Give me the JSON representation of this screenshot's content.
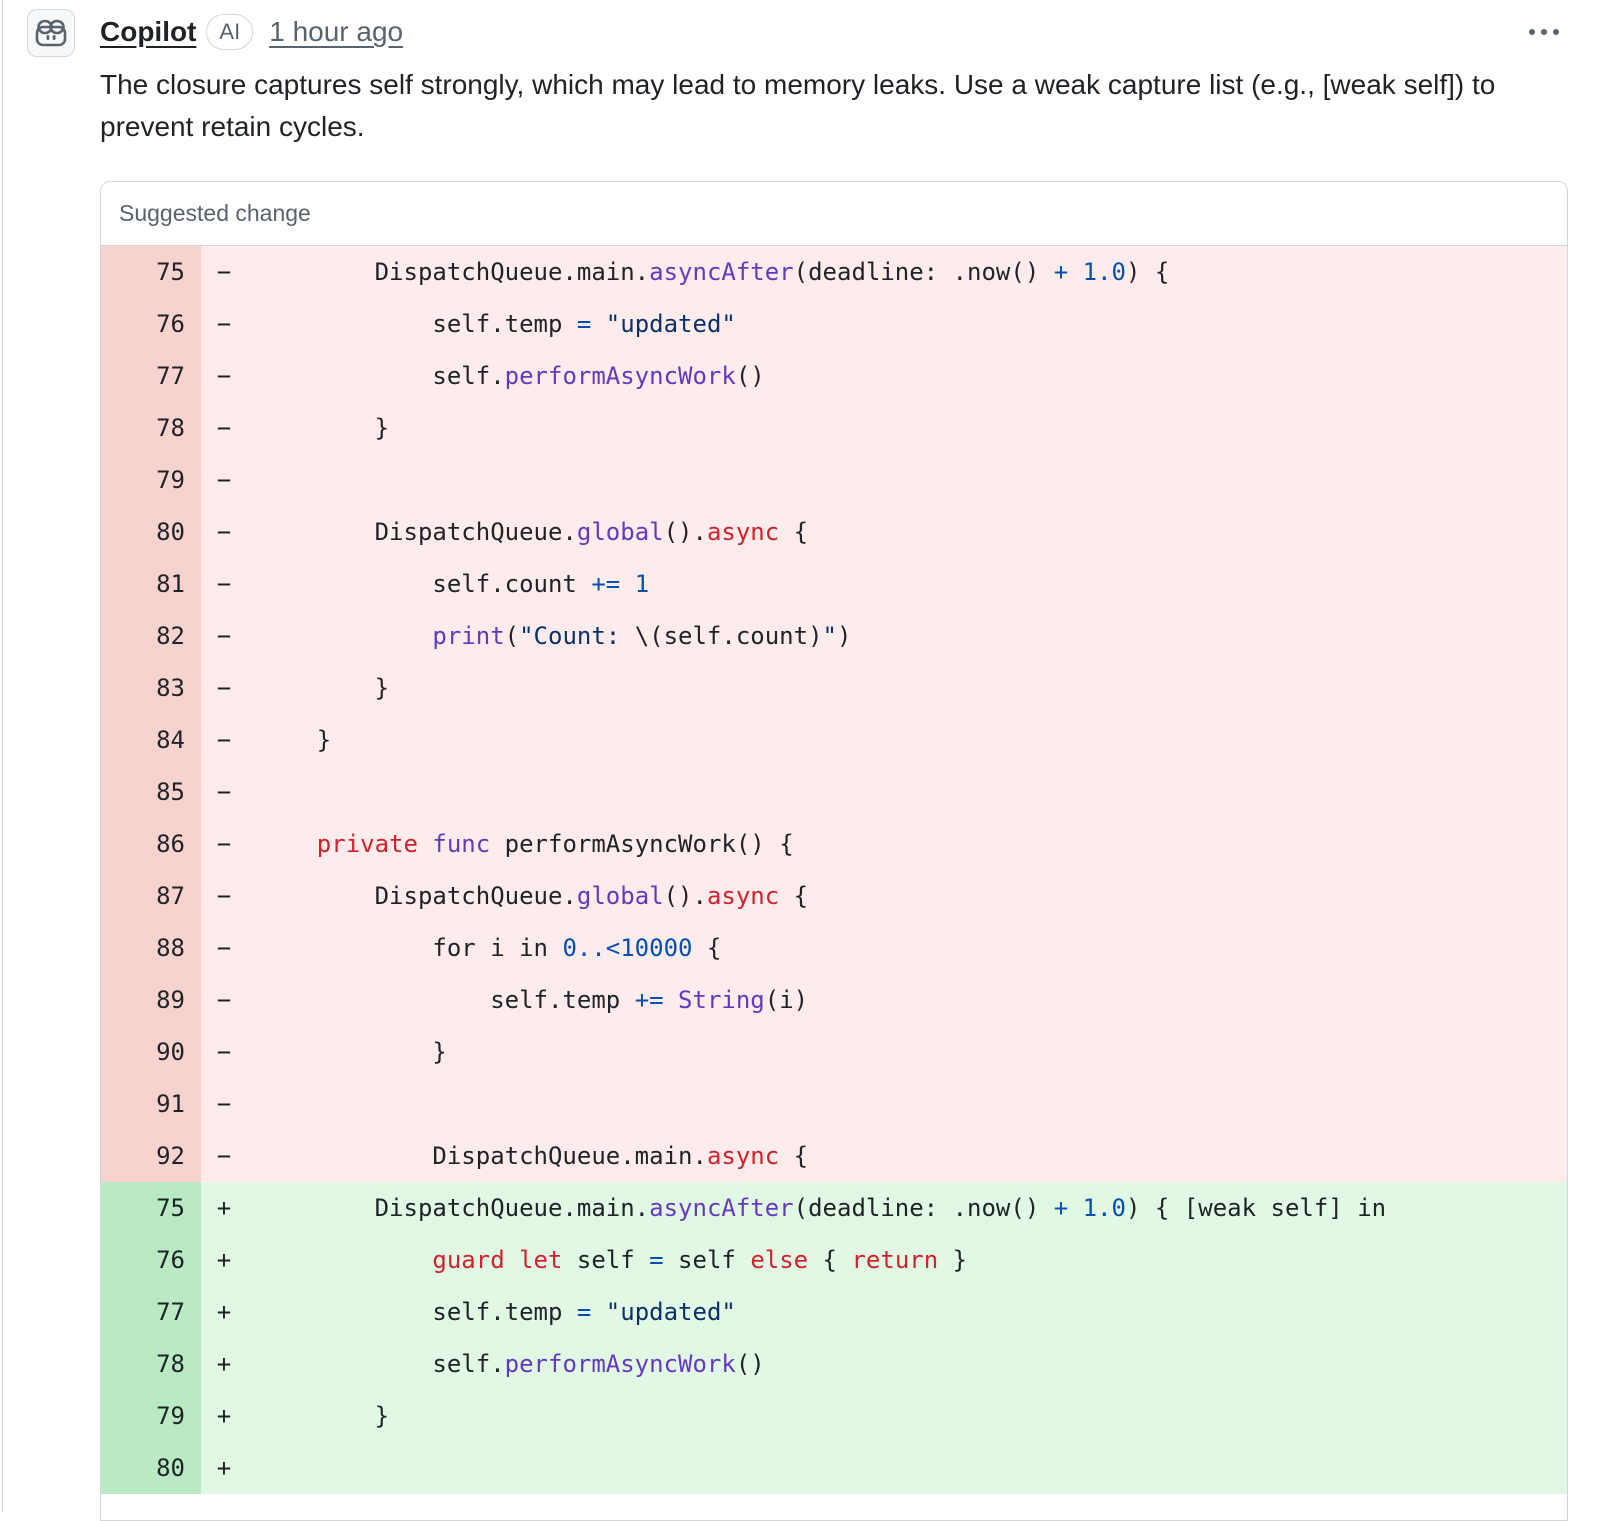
{
  "comment": {
    "author": "Copilot",
    "badge": "AI",
    "time": "1 hour ago",
    "text": "The closure captures self strongly, which may lead to memory leaks. Use a weak capture list (e.g., [weak self]) to prevent retain cycles."
  },
  "suggestion": {
    "header": "Suggested change",
    "lines": [
      {
        "num": "75",
        "mark": "−",
        "type": "del",
        "indent": 8,
        "tokens": [
          [
            "",
            "DispatchQueue.main."
          ],
          [
            "fn",
            "asyncAfter"
          ],
          [
            "",
            "(deadline: .now() "
          ],
          [
            "op",
            "+"
          ],
          [
            "",
            " "
          ],
          [
            "num",
            "1.0"
          ],
          [
            "",
            ") {"
          ]
        ]
      },
      {
        "num": "76",
        "mark": "−",
        "type": "del",
        "indent": 12,
        "tokens": [
          [
            "",
            "self.temp "
          ],
          [
            "op",
            "="
          ],
          [
            "",
            " "
          ],
          [
            "str",
            "\"updated\""
          ]
        ]
      },
      {
        "num": "77",
        "mark": "−",
        "type": "del",
        "indent": 12,
        "tokens": [
          [
            "",
            "self."
          ],
          [
            "fn",
            "performAsyncWork"
          ],
          [
            "",
            "()"
          ]
        ]
      },
      {
        "num": "78",
        "mark": "−",
        "type": "del",
        "indent": 8,
        "tokens": [
          [
            "",
            "}"
          ]
        ]
      },
      {
        "num": "79",
        "mark": "−",
        "type": "del",
        "indent": 0,
        "tokens": []
      },
      {
        "num": "80",
        "mark": "−",
        "type": "del",
        "indent": 8,
        "tokens": [
          [
            "",
            "DispatchQueue."
          ],
          [
            "fn",
            "global"
          ],
          [
            "",
            "()."
          ],
          [
            "kw",
            "async"
          ],
          [
            "",
            " {"
          ]
        ]
      },
      {
        "num": "81",
        "mark": "−",
        "type": "del",
        "indent": 12,
        "tokens": [
          [
            "",
            "self.count "
          ],
          [
            "op",
            "+="
          ],
          [
            "",
            " "
          ],
          [
            "num",
            "1"
          ]
        ]
      },
      {
        "num": "82",
        "mark": "−",
        "type": "del",
        "indent": 12,
        "tokens": [
          [
            "fn",
            "print"
          ],
          [
            "",
            "("
          ],
          [
            "str",
            "\"Count: "
          ],
          [
            "",
            "\\(self.count)"
          ],
          [
            "str",
            "\""
          ],
          [
            "",
            ")"
          ]
        ]
      },
      {
        "num": "83",
        "mark": "−",
        "type": "del",
        "indent": 8,
        "tokens": [
          [
            "",
            "}"
          ]
        ]
      },
      {
        "num": "84",
        "mark": "−",
        "type": "del",
        "indent": 4,
        "tokens": [
          [
            "",
            "}"
          ]
        ]
      },
      {
        "num": "85",
        "mark": "−",
        "type": "del",
        "indent": 0,
        "tokens": []
      },
      {
        "num": "86",
        "mark": "−",
        "type": "del",
        "indent": 4,
        "tokens": [
          [
            "kw",
            "private"
          ],
          [
            "",
            " "
          ],
          [
            "fn",
            "func"
          ],
          [
            "",
            " performAsyncWork() {"
          ]
        ]
      },
      {
        "num": "87",
        "mark": "−",
        "type": "del",
        "indent": 8,
        "tokens": [
          [
            "",
            "DispatchQueue."
          ],
          [
            "fn",
            "global"
          ],
          [
            "",
            "()."
          ],
          [
            "kw",
            "async"
          ],
          [
            "",
            " {"
          ]
        ]
      },
      {
        "num": "88",
        "mark": "−",
        "type": "del",
        "indent": 12,
        "tokens": [
          [
            "",
            "for i in "
          ],
          [
            "num",
            "0..<10000"
          ],
          [
            "",
            " {"
          ]
        ]
      },
      {
        "num": "89",
        "mark": "−",
        "type": "del",
        "indent": 16,
        "tokens": [
          [
            "",
            "self.temp "
          ],
          [
            "op",
            "+="
          ],
          [
            "",
            " "
          ],
          [
            "fn",
            "String"
          ],
          [
            "",
            "(i)"
          ]
        ]
      },
      {
        "num": "90",
        "mark": "−",
        "type": "del",
        "indent": 12,
        "tokens": [
          [
            "",
            "}"
          ]
        ]
      },
      {
        "num": "91",
        "mark": "−",
        "type": "del",
        "indent": 0,
        "tokens": []
      },
      {
        "num": "92",
        "mark": "−",
        "type": "del",
        "indent": 12,
        "tokens": [
          [
            "",
            "DispatchQueue.main."
          ],
          [
            "kw",
            "async"
          ],
          [
            "",
            " {"
          ]
        ]
      },
      {
        "num": "75",
        "mark": "+",
        "type": "add",
        "indent": 8,
        "tokens": [
          [
            "",
            "DispatchQueue.main."
          ],
          [
            "fn",
            "asyncAfter"
          ],
          [
            "",
            "(deadline: .now() "
          ],
          [
            "op",
            "+"
          ],
          [
            "",
            " "
          ],
          [
            "num",
            "1.0"
          ],
          [
            "",
            ") { [weak self] in"
          ]
        ]
      },
      {
        "num": "76",
        "mark": "+",
        "type": "add",
        "indent": 12,
        "tokens": [
          [
            "kw",
            "guard"
          ],
          [
            "",
            " "
          ],
          [
            "kw",
            "let"
          ],
          [
            "",
            " self "
          ],
          [
            "op",
            "="
          ],
          [
            "",
            " self "
          ],
          [
            "kw",
            "else"
          ],
          [
            "",
            " { "
          ],
          [
            "kw",
            "return"
          ],
          [
            "",
            " }"
          ]
        ]
      },
      {
        "num": "77",
        "mark": "+",
        "type": "add",
        "indent": 12,
        "tokens": [
          [
            "",
            "self.temp "
          ],
          [
            "op",
            "="
          ],
          [
            "",
            " "
          ],
          [
            "str",
            "\"updated\""
          ]
        ]
      },
      {
        "num": "78",
        "mark": "+",
        "type": "add",
        "indent": 12,
        "tokens": [
          [
            "",
            "self."
          ],
          [
            "fn",
            "performAsyncWork"
          ],
          [
            "",
            "()"
          ]
        ]
      },
      {
        "num": "79",
        "mark": "+",
        "type": "add",
        "indent": 8,
        "tokens": [
          [
            "",
            "}"
          ]
        ]
      },
      {
        "num": "80",
        "mark": "+",
        "type": "add",
        "indent": 0,
        "tokens": []
      }
    ]
  },
  "icons": {
    "avatar": "copilot-icon",
    "menu": "kebab-menu-icon"
  },
  "colors": {
    "deleted_bg": "#fdeceb",
    "deleted_num_bg": "#f7d3d0",
    "added_bg": "#e1f9e4",
    "added_num_bg": "#b9eac4",
    "keyword": "#cf222e",
    "function": "#6639ba",
    "number": "#0550ae"
  }
}
